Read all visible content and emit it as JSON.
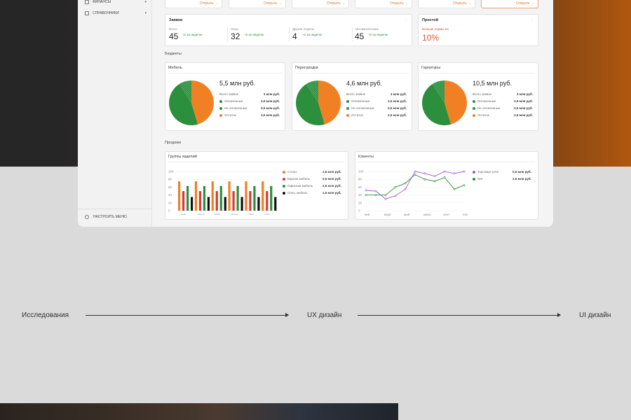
{
  "sidebar": {
    "items": [
      {
        "label": "ФИНАНСЫ"
      },
      {
        "label": "СПРАВОЧНИКИ"
      }
    ],
    "footer_label": "НАСТРОИТЬ МЕНЮ"
  },
  "top_cards": {
    "open_label": "Открыть"
  },
  "requests": {
    "title": "Заявки",
    "stats": [
      {
        "label": "Всего",
        "value": "45",
        "delta": "+2 за неделю"
      },
      {
        "label": "Свои",
        "value": "32",
        "delta": "+2 за неделю"
      },
      {
        "label": "Другие отделы",
        "value": "4",
        "delta": "+2 за неделю"
      },
      {
        "label": "Автоматические",
        "value": "45",
        "delta": "+2 за неделю"
      }
    ]
  },
  "downtime": {
    "title": "Простой",
    "note": "Больше нормы на",
    "value": "10%"
  },
  "sections": {
    "budgets": "Бюджеты",
    "sales": "Продажи"
  },
  "budgets": [
    {
      "title": "Мебель",
      "amount": "5,5 млн руб.",
      "total_label": "Всего заявок",
      "total": "3 млн руб.",
      "rows": [
        {
          "label": "Оплаченные",
          "value": "2,5 млн руб."
        },
        {
          "label": "Не оплаченные",
          "value": "0,5 млн руб."
        },
        {
          "label": "Остаток",
          "value": "2,5 млн руб."
        }
      ]
    },
    {
      "title": "Перегородки",
      "amount": "4,6 млн руб.",
      "total_label": "Всего заявок",
      "total": "3 млн руб.",
      "rows": [
        {
          "label": "Оплаченные",
          "value": "2,5 млн руб."
        },
        {
          "label": "Не оплаченные",
          "value": "0,5 млн руб."
        },
        {
          "label": "Остаток",
          "value": "2,5 млн руб."
        }
      ]
    },
    {
      "title": "Гарнитуры",
      "amount": "10,5 млн руб.",
      "total_label": "Всего заявок",
      "total": "3 млн руб.",
      "rows": [
        {
          "label": "Оплаченные",
          "value": "2,5 млн руб."
        },
        {
          "label": "Не оплаченные",
          "value": "0,5 млн руб."
        },
        {
          "label": "Остаток",
          "value": "2,5 млн руб."
        }
      ]
    }
  ],
  "chart_data": [
    {
      "type": "pie",
      "title": "Мебель",
      "categories": [
        "Оплаченные",
        "Не оплаченные",
        "Остаток"
      ],
      "values": [
        2.5,
        0.5,
        2.5
      ],
      "colors": [
        "#2c8f3e",
        "#2c8f3e",
        "#f08023"
      ]
    },
    {
      "type": "pie",
      "title": "Перегородки",
      "categories": [
        "Оплаченные",
        "Не оплаченные",
        "Остаток"
      ],
      "values": [
        2.5,
        0.5,
        2.5
      ],
      "colors": [
        "#2c8f3e",
        "#2c8f3e",
        "#f08023"
      ]
    },
    {
      "type": "pie",
      "title": "Гарнитуры",
      "categories": [
        "Оплаченные",
        "Не оплаченные",
        "Остаток"
      ],
      "values": [
        2.5,
        0.5,
        2.5
      ],
      "colors": [
        "#2c8f3e",
        "#2c8f3e",
        "#f08023"
      ]
    },
    {
      "type": "bar",
      "title": "Группы изделий",
      "categories": [
        "янв",
        "март",
        "май",
        "июль",
        "сент",
        "ноя"
      ],
      "ylim": [
        0,
        100
      ],
      "yticks": [
        0,
        20,
        40,
        60,
        80,
        100
      ],
      "series": [
        {
          "name": "Столы",
          "color": "#f08023",
          "values": [
            75,
            75,
            75,
            75,
            75,
            75
          ],
          "total": "2,5 млн руб."
        },
        {
          "name": "Барная мебель",
          "color": "#d63a3a",
          "values": [
            50,
            50,
            50,
            50,
            50,
            50
          ],
          "total": "0,5 млн руб."
        },
        {
          "name": "Офисная мебель",
          "color": "#2c8f3e",
          "values": [
            63,
            63,
            63,
            63,
            63,
            63
          ],
          "total": "2,5 млн руб."
        },
        {
          "name": "Спец. мебель",
          "color": "#111111",
          "values": [
            35,
            35,
            35,
            35,
            35,
            35
          ],
          "total": "2,5 млн руб."
        }
      ]
    },
    {
      "type": "line",
      "title": "Клиенты",
      "categories": [
        "янв",
        "март",
        "май",
        "июль",
        "сент",
        "ноя"
      ],
      "ylim": [
        0,
        100
      ],
      "yticks": [
        0,
        20,
        40,
        60,
        80,
        100
      ],
      "x": [
        0,
        1,
        2,
        3,
        4,
        5,
        6,
        7,
        8,
        9,
        10
      ],
      "series": [
        {
          "name": "Торговые сети",
          "color": "#a35ad8",
          "values": [
            52,
            50,
            30,
            38,
            55,
            100,
            95,
            88,
            100,
            95,
            100
          ],
          "total": "0,5 млн руб."
        },
        {
          "name": "Опт",
          "color": "#2c8f3e",
          "values": [
            40,
            40,
            40,
            60,
            70,
            92,
            80,
            75,
            85,
            55,
            65
          ],
          "total": "2,5 млн руб."
        }
      ]
    }
  ],
  "process": {
    "steps": [
      "Исследования",
      "UX дизайн",
      "UI дизайн"
    ]
  }
}
